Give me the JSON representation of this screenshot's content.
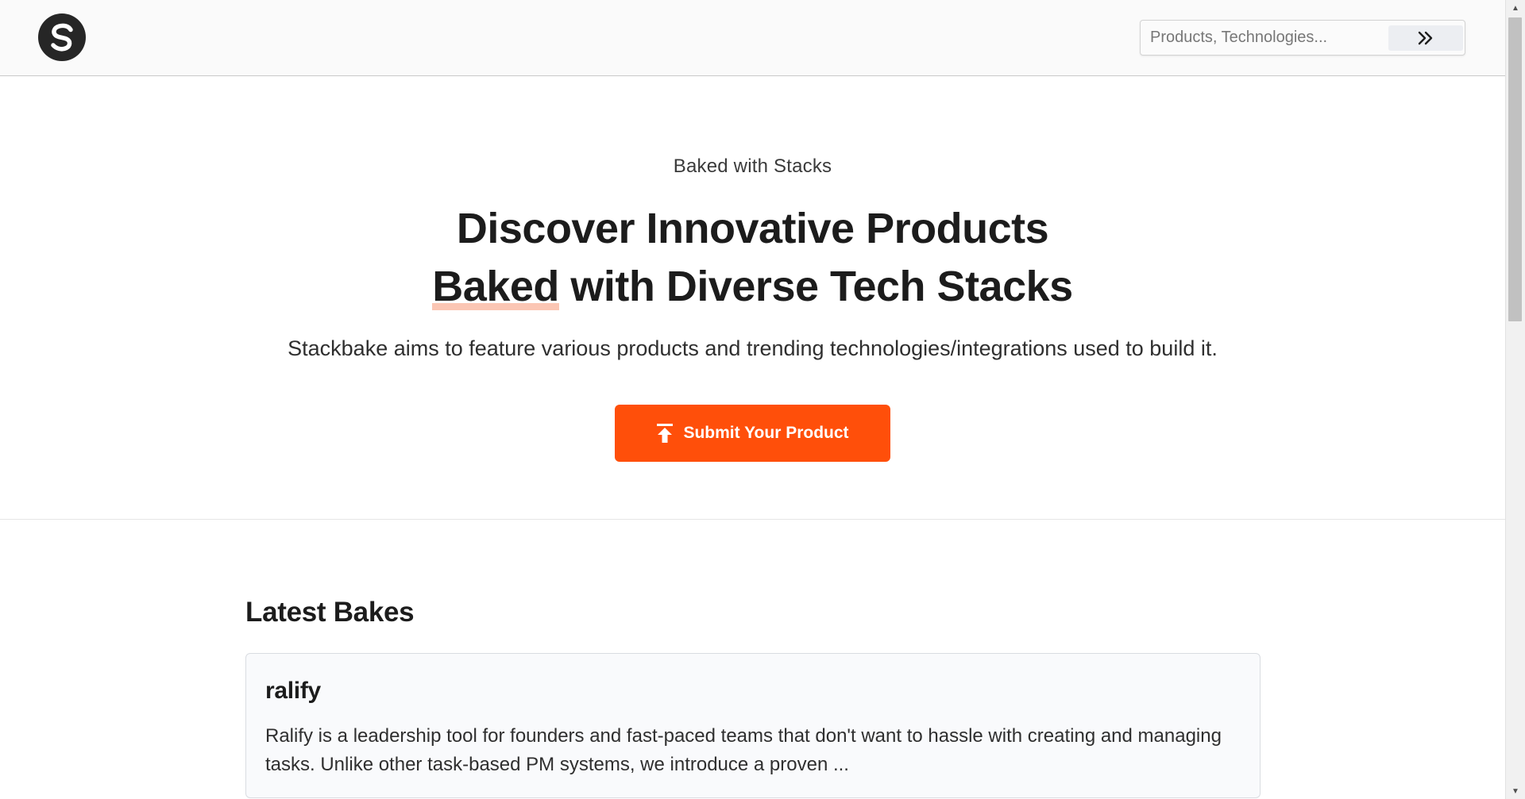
{
  "header": {
    "search": {
      "placeholder": "Products, Technologies...",
      "submit_icon": "double-chevron-right-icon"
    },
    "logo_icon": "stackbake-logo-icon"
  },
  "hero": {
    "eyebrow": "Baked with Stacks",
    "headline_line1": "Discover Innovative Products",
    "headline_highlight": "Baked",
    "headline_line2_rest": " with Diverse Tech Stacks",
    "subtitle": "Stackbake aims to feature various products and trending technologies/integrations used to build it.",
    "cta": {
      "label": "Submit Your Product",
      "icon": "upload-arrow-icon",
      "color": "#ff4f0a"
    }
  },
  "latest": {
    "title": "Latest Bakes",
    "items": [
      {
        "name": "ralify",
        "description": "Ralify is a leadership tool for founders and fast-paced teams that don't want to hassle with creating and managing tasks. Unlike other task-based PM systems, we introduce a proven ..."
      }
    ]
  },
  "colors": {
    "accent": "#ff4f0a",
    "highlight": "#fbc6b4",
    "header_bg": "#fafafa"
  }
}
